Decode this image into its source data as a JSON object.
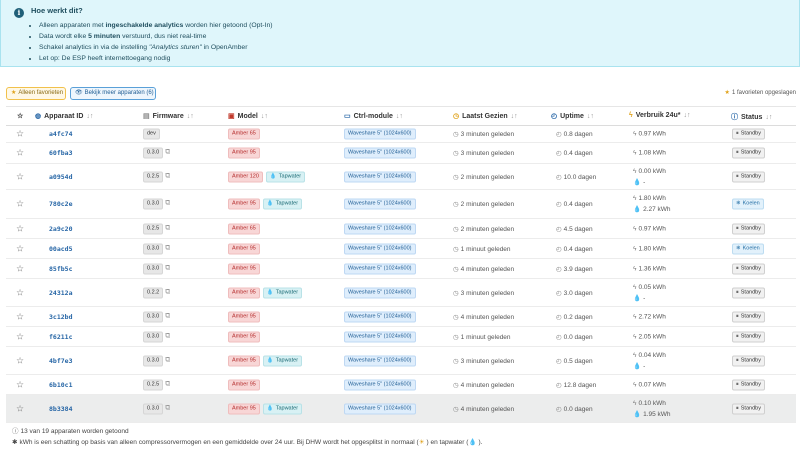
{
  "info": {
    "title": "Hoe werkt dit?",
    "bullets": [
      {
        "pre": "Alleen apparaten met ",
        "bold": "ingeschakelde analytics",
        "post": " worden hier getoond (Opt-In)"
      },
      {
        "pre": "Data wordt elke ",
        "bold": "5 minuten",
        "post": " verstuurd, dus niet real-time"
      },
      {
        "pre": "Schakel analytics in via de instelling ",
        "italic": "\"Analytics sturen\"",
        "post": " in OpenAmber"
      },
      {
        "pre": "Let op: De ESP heeft internettoegang nodig"
      }
    ]
  },
  "toolbar": {
    "favorites_label": "Alleen favorieten",
    "more_label": "Bekijk meer apparaten (6)",
    "fav_count": "1 favorieten opgeslagen"
  },
  "columns": {
    "id": "Apparaat ID",
    "firmware": "Firmware",
    "model": "Model",
    "ctrl": "Ctrl-module",
    "seen": "Laatst Gezien",
    "uptime": "Uptime",
    "usage": "Verbruik 24u*",
    "status": "Status"
  },
  "rows": [
    {
      "id": "a4fc74",
      "fw": "dev",
      "model": "Amber 65",
      "tap": "",
      "ctrl": "Waveshare 5\" (1024x600)",
      "seen": "3 minuten geleden",
      "uptime": "0.8 dagen",
      "use1": "0.97 kWh",
      "use2": "",
      "status": "Standby",
      "cool": false
    },
    {
      "id": "60fba3",
      "fw": "0.3.0",
      "model": "Amber 95",
      "tap": "",
      "ctrl": "Waveshare 5\" (1024x600)",
      "seen": "3 minuten geleden",
      "uptime": "0.4 dagen",
      "use1": "1.08 kWh",
      "use2": "",
      "status": "Standby",
      "cool": false
    },
    {
      "id": "a0954d",
      "fw": "0.2.5",
      "model": "Amber 120",
      "tap": "Tapwater",
      "ctrl": "Waveshare 5\" (1024x600)",
      "seen": "2 minuten geleden",
      "uptime": "10.0 dagen",
      "use1": "0.00 kWh",
      "use2": "-",
      "status": "Standby",
      "cool": false
    },
    {
      "id": "780c2e",
      "fw": "0.3.0",
      "model": "Amber 95",
      "tap": "Tapwater",
      "ctrl": "Waveshare 5\" (1024x600)",
      "seen": "2 minuten geleden",
      "uptime": "0.4 dagen",
      "use1": "1.80 kWh",
      "use2": "2.27 kWh",
      "status": "Koelen",
      "cool": true
    },
    {
      "id": "2a9c20",
      "fw": "0.2.5",
      "model": "Amber 65",
      "tap": "",
      "ctrl": "Waveshare 5\" (1024x600)",
      "seen": "2 minuten geleden",
      "uptime": "4.5 dagen",
      "use1": "0.97 kWh",
      "use2": "",
      "status": "Standby",
      "cool": false
    },
    {
      "id": "00acd5",
      "fw": "0.3.0",
      "model": "Amber 95",
      "tap": "",
      "ctrl": "Waveshare 5\" (1024x600)",
      "seen": "1 minuut geleden",
      "uptime": "0.4 dagen",
      "use1": "1.80 kWh",
      "use2": "",
      "status": "Koelen",
      "cool": true
    },
    {
      "id": "85fb5c",
      "fw": "0.3.0",
      "model": "Amber 95",
      "tap": "",
      "ctrl": "Waveshare 5\" (1024x600)",
      "seen": "4 minuten geleden",
      "uptime": "3.9 dagen",
      "use1": "1.36 kWh",
      "use2": "",
      "status": "Standby",
      "cool": false
    },
    {
      "id": "24312a",
      "fw": "0.2.2",
      "model": "Amber 95",
      "tap": "Tapwater",
      "ctrl": "Waveshare 5\" (1024x600)",
      "seen": "3 minuten geleden",
      "uptime": "3.0 dagen",
      "use1": "0.05 kWh",
      "use2": "-",
      "status": "Standby",
      "cool": false
    },
    {
      "id": "3c12bd",
      "fw": "0.3.0",
      "model": "Amber 95",
      "tap": "",
      "ctrl": "Waveshare 5\" (1024x600)",
      "seen": "4 minuten geleden",
      "uptime": "0.2 dagen",
      "use1": "2.72 kWh",
      "use2": "",
      "status": "Standby",
      "cool": false
    },
    {
      "id": "f6211c",
      "fw": "0.3.0",
      "model": "Amber 95",
      "tap": "",
      "ctrl": "Waveshare 5\" (1024x600)",
      "seen": "1 minuut geleden",
      "uptime": "0.0 dagen",
      "use1": "2.05 kWh",
      "use2": "",
      "status": "Standby",
      "cool": false
    },
    {
      "id": "4bf7e3",
      "fw": "0.3.0",
      "model": "Amber 95",
      "tap": "Tapwater",
      "ctrl": "Waveshare 5\" (1024x600)",
      "seen": "3 minuten geleden",
      "uptime": "0.5 dagen",
      "use1": "0.04 kWh",
      "use2": "-",
      "status": "Standby",
      "cool": false
    },
    {
      "id": "6b10c1",
      "fw": "0.2.5",
      "model": "Amber 95",
      "tap": "",
      "ctrl": "Waveshare 5\" (1024x600)",
      "seen": "4 minuten geleden",
      "uptime": "12.8 dagen",
      "use1": "0.07 kWh",
      "use2": "",
      "status": "Standby",
      "cool": false
    },
    {
      "id": "8b3384",
      "fw": "0.3.0",
      "model": "Amber 95",
      "tap": "Tapwater",
      "ctrl": "Waveshare 5\" (1024x600)",
      "seen": "4 minuten geleden",
      "uptime": "0.0 dagen",
      "use1": "0.10 kWh",
      "use2": "1.95 kWh",
      "status": "Standby",
      "cool": false
    }
  ],
  "footer": {
    "count": "13 van 19 apparaten worden getoond",
    "note_pre": "kWh is een schatting op basis van alleen compressorvermogen en een gemiddelde over 24 uur. Bij DHW wordt het opgesplitst in normaal (",
    "note_mid": ") en tapwater (",
    "note_post": ")."
  }
}
